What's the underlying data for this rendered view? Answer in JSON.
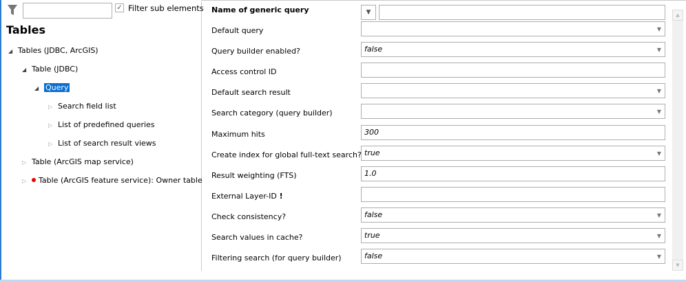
{
  "filter": {
    "icon": "funnel-icon",
    "value": "",
    "checkbox_label": "Filter sub elements",
    "checked": true
  },
  "tree": {
    "title": "Tables",
    "items": [
      {
        "label": "Tables (JDBC, ArcGIS)",
        "expanded": true
      },
      {
        "label": "Table (JDBC)",
        "expanded": true
      },
      {
        "label": "Query",
        "expanded": true,
        "selected": true
      },
      {
        "label": "Search field list",
        "expanded": false
      },
      {
        "label": "List of predefined queries",
        "expanded": false
      },
      {
        "label": "List of search result views",
        "expanded": false
      },
      {
        "label": "Table (ArcGIS map service)",
        "expanded": false
      },
      {
        "label": "Table (ArcGIS feature service): Owner table",
        "expanded": false,
        "error": true
      }
    ]
  },
  "form": {
    "name_label": "Name of generic query",
    "rows": [
      {
        "label": "Default query",
        "value": "",
        "type": "dropdown"
      },
      {
        "label": "Query builder enabled?",
        "value": "false",
        "type": "dropdown"
      },
      {
        "label": "Access control ID",
        "value": "",
        "type": "text"
      },
      {
        "label": "Default search result",
        "value": "",
        "type": "dropdown"
      },
      {
        "label": "Search category (query builder)",
        "value": "",
        "type": "dropdown"
      },
      {
        "label": "Maximum hits",
        "value": "300",
        "type": "text"
      },
      {
        "label": "Create index for global full-text search?",
        "value": "true",
        "type": "dropdown"
      },
      {
        "label": "Result weighting (FTS)",
        "value": "1.0",
        "type": "text"
      },
      {
        "label": "External Layer-ID",
        "marker": "!",
        "value": "",
        "type": "text"
      },
      {
        "label": "Check consistency?",
        "value": "false",
        "type": "dropdown"
      },
      {
        "label": "Search values in cache?",
        "value": "true",
        "type": "dropdown"
      },
      {
        "label": "Filtering search (for query builder)",
        "value": "false",
        "type": "dropdown"
      }
    ]
  },
  "colors": {
    "selection": "#0a6fcf",
    "accent": "#2b7bd4",
    "error_dot": "#e00000"
  }
}
